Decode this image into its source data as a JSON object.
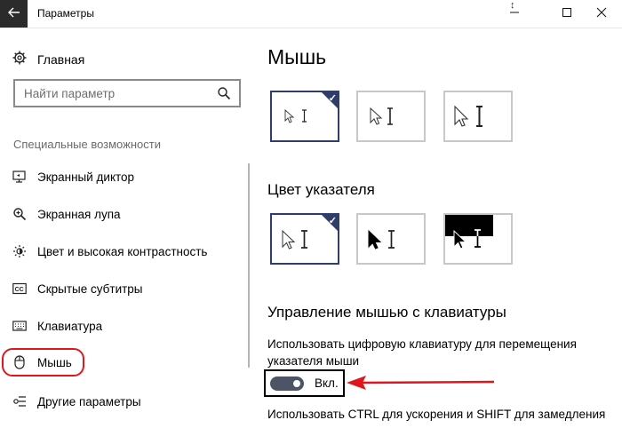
{
  "window": {
    "title": "Параметры",
    "buttons": {
      "minimize_icon": "minimize-icon",
      "maximize_icon": "maximize-icon",
      "close_icon": "close-icon"
    }
  },
  "sidebar": {
    "home_label": "Главная",
    "search_placeholder": "Найти параметр",
    "section_label": "Специальные возможности",
    "items": [
      {
        "label": "Экранный диктор",
        "icon": "narrator-icon"
      },
      {
        "label": "Экранная лупа",
        "icon": "magnifier-icon"
      },
      {
        "label": "Цвет и высокая контрастность",
        "icon": "brightness-icon"
      },
      {
        "label": "Скрытые субтитры",
        "icon": "captions-icon"
      },
      {
        "label": "Клавиатура",
        "icon": "keyboard-icon"
      },
      {
        "label": "Мышь",
        "icon": "mouse-icon",
        "selected": true
      },
      {
        "label": "Другие параметры",
        "icon": "other-icon"
      }
    ]
  },
  "main": {
    "title": "Мышь",
    "pointer_size_tiles": [
      {
        "selected": true
      },
      {
        "selected": false
      },
      {
        "selected": false
      }
    ],
    "pointer_color_heading": "Цвет указателя",
    "pointer_color_tiles": [
      {
        "style": "white",
        "selected": true
      },
      {
        "style": "black",
        "selected": false
      },
      {
        "style": "inverted",
        "selected": false
      }
    ],
    "mouse_keys_heading": "Управление мышью с клавиатуры",
    "mouse_keys_desc_line1": "Использовать цифровую клавиатуру для перемещения",
    "mouse_keys_desc_line2": "указателя мыши",
    "toggle_label": "Вкл.",
    "toggle_on": true,
    "ctrl_shift_text": "Использовать CTRL для ускорения и SHIFT для замедления"
  },
  "colors": {
    "accent": "#2f3d6b",
    "annotation": "#e0161d",
    "toggle": "#4d5466"
  }
}
